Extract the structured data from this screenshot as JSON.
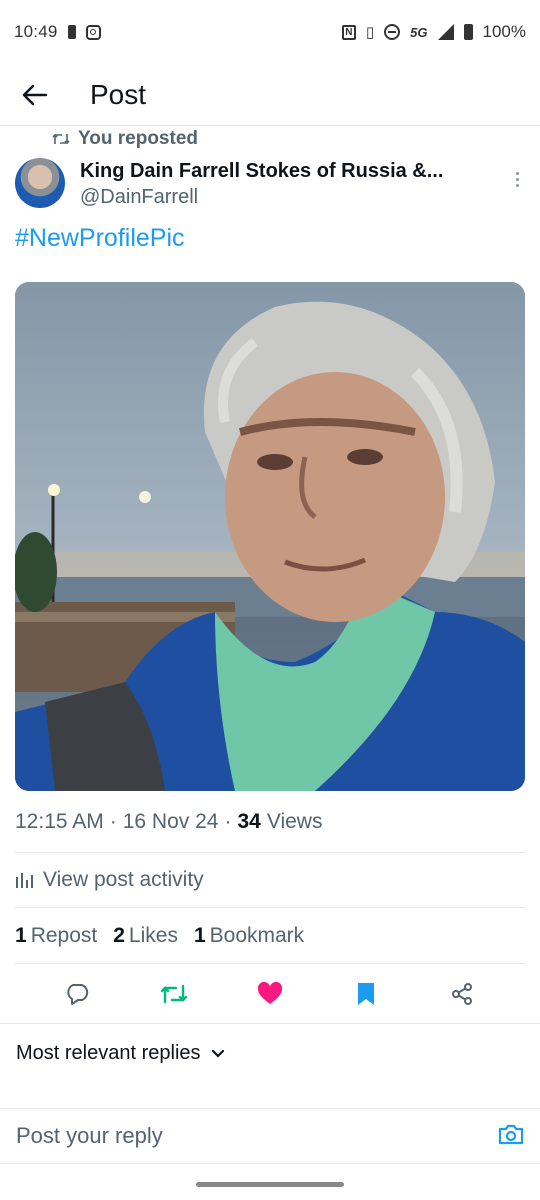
{
  "status_bar": {
    "time": "10:49",
    "network": "5G",
    "battery": "100%"
  },
  "header": {
    "title": "Post",
    "back_icon": "arrow-left-icon"
  },
  "repost": {
    "label": "You reposted",
    "icon": "repost-icon"
  },
  "author": {
    "name": "King Dain Farrell Stokes of Russia &...",
    "handle": "@DainFarrell"
  },
  "post": {
    "text": "#NewProfilePic",
    "time": "12:15 AM",
    "date": "16 Nov 24",
    "views_count": "34",
    "views_label": "Views",
    "separator": "·"
  },
  "activity": {
    "label": "View post activity",
    "icon": "analytics-icon"
  },
  "stats": {
    "reposts_count": "1",
    "reposts_label": "Repost",
    "likes_count": "2",
    "likes_label": "Likes",
    "bookmarks_count": "1",
    "bookmarks_label": "Bookmark"
  },
  "actions": {
    "reply_icon": "reply-icon",
    "repost_icon": "repost-icon",
    "like_icon": "heart-icon",
    "bookmark_icon": "bookmark-icon",
    "share_icon": "share-icon",
    "repost_color": "#00ba7c",
    "like_color": "#f91880",
    "bookmark_color": "#1d9bf0"
  },
  "replies": {
    "sort_label": "Most relevant replies"
  },
  "reply_bar": {
    "placeholder": "Post your reply",
    "camera_icon": "camera-icon"
  },
  "colors": {
    "accent": "#1d9bf0",
    "text_primary": "#0f1419",
    "text_secondary": "#536471"
  }
}
